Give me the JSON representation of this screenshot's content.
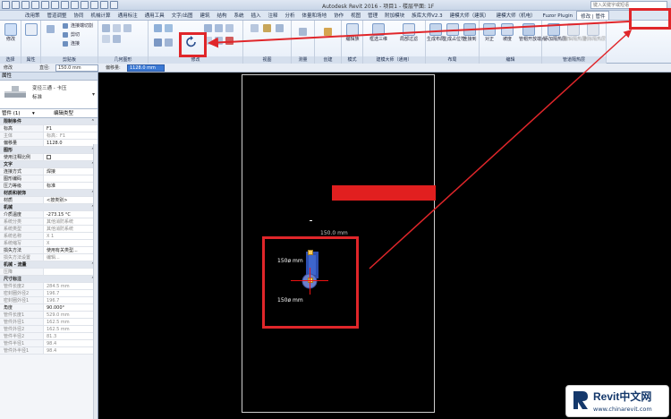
{
  "titlebar": {
    "title": "Autodesk Revit 2016 - 项目1 - 楼层平面: 1F",
    "search_placeholder": "键入关键字或短语"
  },
  "tabs": [
    "建筑",
    "结构",
    "系统",
    "插入",
    "注释",
    "分析",
    "体量和场地",
    "协作",
    "视图",
    "管理",
    "附加模块",
    "族库大师V2.3",
    "建模大师（建筑）",
    "建模大师（机电）",
    "Fuzor Plugin",
    "修改 | 管件"
  ],
  "left_tabs": [
    "改用策",
    "管道调整",
    "协同",
    "机械计算",
    "通用标注",
    "通用工具",
    "文字/出图"
  ],
  "ribbon": {
    "modify_label": "修改",
    "select_label": "选择",
    "properties_label": "属性",
    "clipboard_label": "剪贴板",
    "clipboard_items": [
      "连接端切割",
      "剪切",
      "连接"
    ],
    "geometry_label": "几何图形",
    "modify_panel_label": "修改",
    "view_label": "视图",
    "measure_label": "测量",
    "create_label": "创建",
    "mode_label": "模式",
    "mode_buttons": [
      "编辑族"
    ],
    "builder_label": "建模大师（通用）",
    "builder_buttons": [
      "框选三维",
      "局部过滤"
    ],
    "layout_label": "布局",
    "layout_buttons": [
      "生成布局",
      "生成占位符",
      "连接到"
    ],
    "edit_label": "编辑",
    "edit_buttons": [
      "对正",
      "坡度",
      "管帽开放端点"
    ],
    "insulation_label": "管道隔热层",
    "insulation_buttons": [
      "添加隔热层",
      "编辑隔热层",
      "删除隔热层"
    ]
  },
  "options": {
    "modify_label": "修改",
    "diameter_label": "直径:",
    "diameter_value": "150.0 mm",
    "offset_label": "偏移量:",
    "offset_value": "1128.0 mm"
  },
  "properties": {
    "title": "属性",
    "type_name": "变径三通 - 卡压",
    "type_sub": "标准",
    "instance_filter": "管件 (1)",
    "edit_type": "编辑类型",
    "rows": [
      {
        "kind": "group",
        "name": "限制条件"
      },
      {
        "name": "标高",
        "value": "F1"
      },
      {
        "name": "主体",
        "value": "标高：F1",
        "dim": true
      },
      {
        "name": "偏移量",
        "value": "1128.0"
      },
      {
        "kind": "group",
        "name": "图形"
      },
      {
        "name": "使用注释比例",
        "value": "",
        "check": true
      },
      {
        "kind": "group",
        "name": "文字"
      },
      {
        "name": "连接方式",
        "value": "焊接"
      },
      {
        "name": "图形编码",
        "value": ""
      },
      {
        "name": "压力等级",
        "value": "标准"
      },
      {
        "kind": "group",
        "name": "材质和装饰"
      },
      {
        "name": "材质",
        "value": "<按类别>"
      },
      {
        "kind": "group",
        "name": "机械"
      },
      {
        "name": "介质温度",
        "value": "-273.15 °C"
      },
      {
        "name": "系统分类",
        "value": "其他消防系统",
        "dim": true
      },
      {
        "name": "系统类型",
        "value": "其他消防系统",
        "dim": true
      },
      {
        "name": "系统名称",
        "value": "X 1",
        "dim": true
      },
      {
        "name": "系统缩写",
        "value": "X",
        "dim": true
      },
      {
        "name": "损失方法",
        "value": "使用有关类型..."
      },
      {
        "name": "损失方法设置",
        "value": "编辑...",
        "dim": true
      },
      {
        "kind": "group",
        "name": "机械 - 流量"
      },
      {
        "name": "压降",
        "value": "",
        "dim": true
      },
      {
        "kind": "group",
        "name": "尺寸标注"
      },
      {
        "name": "管件长度2",
        "value": "284.5 mm",
        "dim": true
      },
      {
        "name": "密封圈外径2",
        "value": "196.7",
        "dim": true
      },
      {
        "name": "密封圈外径1",
        "value": "196.7",
        "dim": true
      },
      {
        "name": "角度",
        "value": "90.000°"
      },
      {
        "name": "管件长度1",
        "value": "529.0 mm",
        "dim": true
      },
      {
        "name": "管件外径1",
        "value": "162.5 mm",
        "dim": true
      },
      {
        "name": "管件外径2",
        "value": "162.5 mm",
        "dim": true
      },
      {
        "name": "管件半径2",
        "value": "81.3",
        "dim": true
      },
      {
        "name": "管件半径1",
        "value": "98.4",
        "dim": true
      },
      {
        "name": "管件外半径1",
        "value": "98.4",
        "dim": true
      }
    ]
  },
  "canvas": {
    "dim_top": "150.0 mm",
    "dim_a": "150ø mm",
    "dim_b": "150ø mm"
  },
  "watermark": {
    "title": "Revit中文网",
    "url": "www.chinarevit.com"
  },
  "colors": {
    "annotation_red": "#e0262a",
    "offset_highlight": "#3b79d4"
  }
}
